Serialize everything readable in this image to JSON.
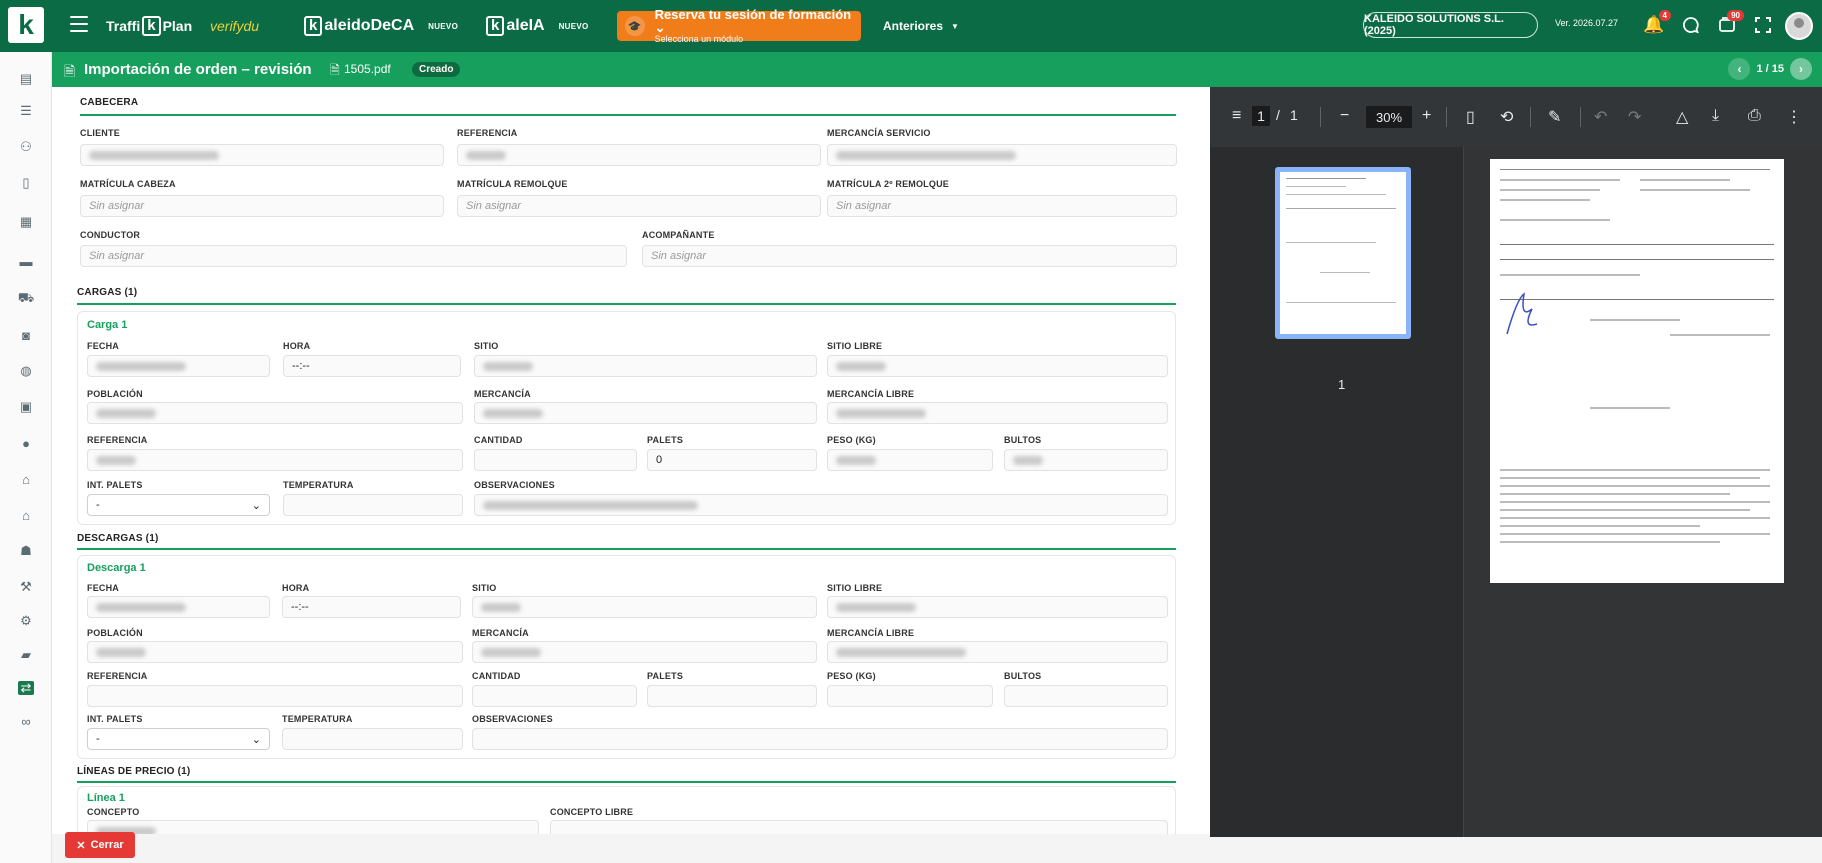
{
  "topbar": {
    "menu_icon": "hamburger-icon",
    "product1_a": "Traffi",
    "product1_k": "k",
    "product1_b": "Plan",
    "product2": "verifydu",
    "product3_k": "k",
    "product3_a": "aleido ",
    "product3_b": "DeCA",
    "product3_badge": "NUEVO",
    "product4_k": "k",
    "product4_a": "ale",
    "product4_b": "IA",
    "product4_badge": "NUEVO",
    "promo_title": "Reserva tu sesión de formación",
    "promo_sub": "Selecciona un módulo",
    "anteriores": "Anteriores",
    "company": "KALEIDO SOLUTIONS S.L. (2025)",
    "version": "Ver. 2026.07.27",
    "notif_count": "4",
    "tasks_count": "90"
  },
  "subbar": {
    "title": "Importación de orden – revisión",
    "file": "1505.pdf",
    "state": "Creado",
    "pager": "1 / 15"
  },
  "cabecera": {
    "section": "CABECERA",
    "cliente_label": "CLIENTE",
    "referencia_label": "REFERENCIA",
    "mercancia_servicio_label": "MERCANCÍA SERVICIO",
    "matricula_cabeza_label": "MATRÍCULA CABEZA",
    "matricula_cabeza_ph": "Sin asignar",
    "matricula_remolque_label": "MATRÍCULA REMOLQUE",
    "matricula_remolque_ph": "Sin asignar",
    "matricula_2_label": "MATRÍCULA 2º REMOLQUE",
    "matricula_2_ph": "Sin asignar",
    "conductor_label": "CONDUCTOR",
    "conductor_ph": "Sin asignar",
    "acompanante_label": "ACOMPAÑANTE",
    "acompanante_ph": "Sin asignar"
  },
  "cargas": {
    "section": "CARGAS (1)",
    "card_title": "Carga 1",
    "fecha": "FECHA",
    "hora": "HORA",
    "hora_value": "--:--",
    "sitio": "SITIO",
    "sitio_libre": "SITIO LIBRE",
    "poblacion": "POBLACIÓN",
    "mercancia": "MERCANCÍA",
    "mercancia_libre": "MERCANCÍA LIBRE",
    "referencia": "REFERENCIA",
    "cantidad": "CANTIDAD",
    "palets": "PALETS",
    "palets_value": "0",
    "peso": "PESO (KG)",
    "bultos": "BULTOS",
    "int_palets": "INT. PALETS",
    "int_palets_value": "-",
    "temperatura": "TEMPERATURA",
    "observaciones": "OBSERVACIONES"
  },
  "descargas": {
    "section": "DESCARGAS (1)",
    "card_title": "Descarga 1",
    "fecha": "FECHA",
    "hora": "HORA",
    "hora_value": "--:--",
    "sitio": "SITIO",
    "sitio_libre": "SITIO LIBRE",
    "poblacion": "POBLACIÓN",
    "mercancia": "MERCANCÍA",
    "mercancia_libre": "MERCANCÍA LIBRE",
    "referencia": "REFERENCIA",
    "cantidad": "CANTIDAD",
    "palets": "PALETS",
    "peso": "PESO (KG)",
    "bultos": "BULTOS",
    "int_palets": "INT. PALETS",
    "int_palets_value": "-",
    "temperatura": "TEMPERATURA",
    "observaciones": "OBSERVACIONES"
  },
  "precios": {
    "section": "LÍNEAS DE PRECIO (1)",
    "card_title": "Línea 1",
    "concepto": "CONCEPTO",
    "concepto_libre": "CONCEPTO LIBRE"
  },
  "footer": {
    "cerrar": "Cerrar"
  },
  "pdf_viewer": {
    "page_current": "1",
    "page_sep": "/",
    "page_total": "1",
    "zoom": "30%",
    "thumb_label": "1"
  },
  "colors": {
    "brand": "#0b6b45",
    "accent": "#17a05d",
    "promo": "#f07c1a",
    "danger": "#e53935"
  }
}
